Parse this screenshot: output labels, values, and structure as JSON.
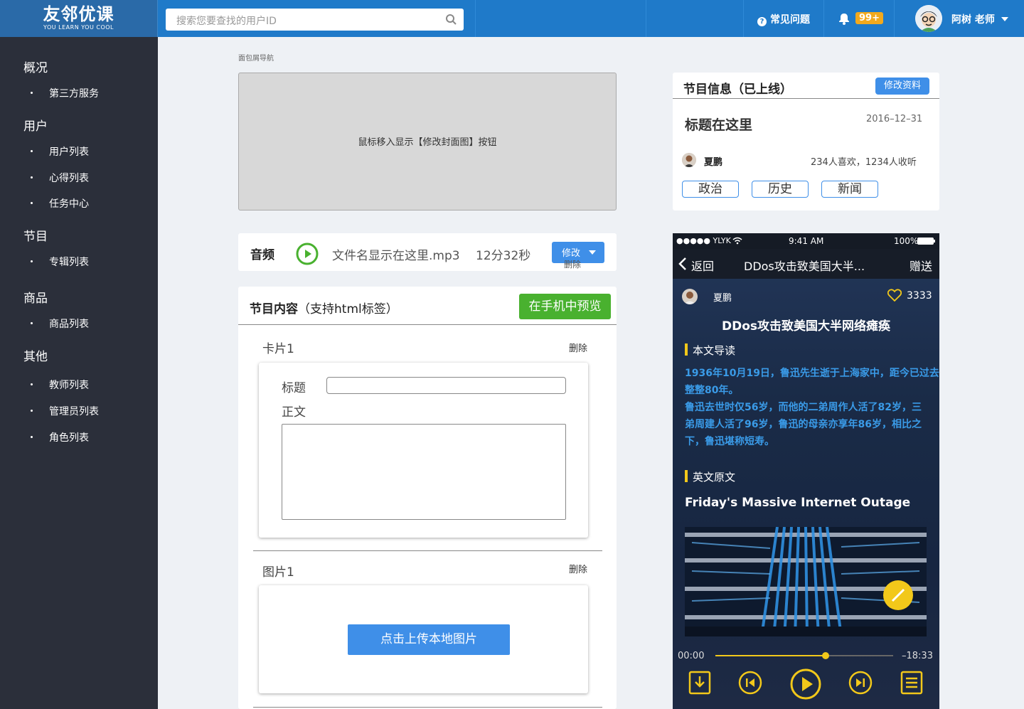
{
  "brand": {
    "name": "友邻优课",
    "tagline": "YOU LEARN YOU COOL"
  },
  "search": {
    "placeholder": "搜索您要查找的用户ID"
  },
  "header": {
    "faq_label": "常见问题",
    "notification_count": "99+",
    "user_name": "阿树 老师"
  },
  "sidebar": {
    "sections": [
      {
        "title": "概况",
        "items": [
          "第三方服务"
        ]
      },
      {
        "title": "用户",
        "items": [
          "用户列表",
          "心得列表",
          "任务中心"
        ]
      },
      {
        "title": "节目",
        "items": [
          "专辑列表"
        ]
      },
      {
        "title": "商品",
        "items": [
          "商品列表"
        ]
      },
      {
        "title": "其他",
        "items": [
          "教师列表",
          "管理员列表",
          "角色列表"
        ]
      }
    ]
  },
  "breadcrumb": "面包屑导航",
  "cover": {
    "hint": "鼠标移入显示【修改封面图】按钮"
  },
  "audio": {
    "label": "音频",
    "filename": "文件名显示在这里.mp3",
    "duration": "12分32秒",
    "edit_label": "修改",
    "delete_label": "删除"
  },
  "content": {
    "title_bold": "节目内容",
    "title_rest": "（支持html标签）",
    "preview_label": "在手机中预览",
    "cards": [
      {
        "name": "卡片1",
        "delete_label": "删除",
        "title_label": "标题",
        "body_label": "正文",
        "title_value": "",
        "body_value": ""
      },
      {
        "name": "图片1",
        "delete_label": "删除",
        "upload_label": "点击上传本地图片"
      }
    ]
  },
  "info": {
    "header": "节目信息（已上线）",
    "edit_label": "修改资料",
    "title": "标题在这里",
    "date": "2016–12–31",
    "author": "夏鹏",
    "stats": "234人喜欢，1234人收听",
    "tags": [
      "政治",
      "历史",
      "新闻"
    ]
  },
  "phone": {
    "carrier": "●●●●● YLYK",
    "time": "9:41 AM",
    "battery": "100%",
    "back_label": "返回",
    "nav_title": "DDos攻击致美国大半...",
    "gift_label": "赠送",
    "author": "夏鹏",
    "likes": "3333",
    "article_title": "DDos攻击致美国大半网络瘫痪",
    "intro_label": "本文导读",
    "intro_lines": [
      "1936年10月19日，鲁迅先生逝于上海家中，距今已过去",
      "整整80年。",
      "鲁迅去世时仅56岁，而他的二弟周作人活了82岁，三",
      "弟周建人活了96岁，鲁迅的母亲亦享年86岁，相比之",
      "下，鲁迅堪称短寿。"
    ],
    "original_label": "英文原文",
    "original_title": "Friday's Massive Internet Outage",
    "elapsed": "00:00",
    "remaining": "–18:33",
    "progress": 0.62
  },
  "colors": {
    "topbar": "#1f7ac9",
    "sidebar": "#2b2f3a",
    "accent_blue": "#3f8fe8",
    "accent_green": "#49b12f",
    "badge": "#f2a91d",
    "phone_highlight": "#f2c81a"
  }
}
